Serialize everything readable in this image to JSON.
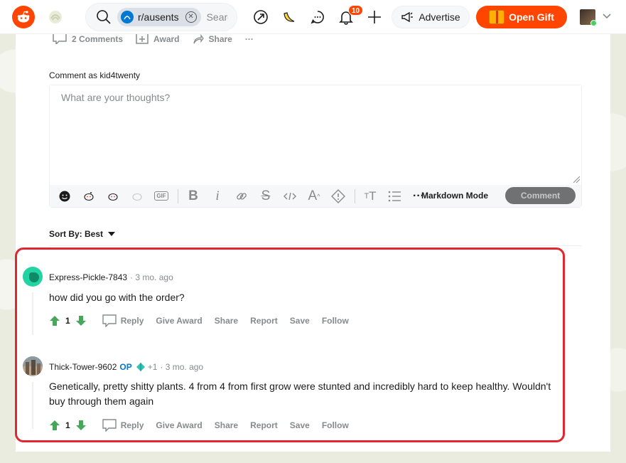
{
  "header": {
    "search": {
      "community_chip": "r/ausents",
      "placeholder": "Search Reddit"
    },
    "notification_count": "10",
    "advertise_label": "Advertise",
    "open_gift_label": "Open Gift"
  },
  "post_actions": {
    "comments": "2 Comments",
    "award": "Award",
    "share": "Share",
    "more": "···"
  },
  "editor": {
    "comment_as": "Comment as kid4twenty",
    "placeholder": "What are your thoughts?",
    "markdown_mode": "Markdown Mode",
    "comment_button": "Comment",
    "gif_label": "GIF"
  },
  "sort": {
    "label": "Sort By: Best"
  },
  "comments": [
    {
      "author": "Express-Pickle-7843",
      "ago": "· 3 mo. ago",
      "body": "how did you go with the order?",
      "score": "1",
      "actions": {
        "reply": "Reply",
        "give_award": "Give Award",
        "share": "Share",
        "report": "Report",
        "save": "Save",
        "follow": "Follow"
      }
    },
    {
      "author": "Thick-Tower-9602",
      "op": "OP",
      "flair_extra": "+1",
      "ago": "· 3 mo. ago",
      "body": "Genetically, pretty shitty plants. 4 from 4 from first grow were stunted and incredibly hard to keep healthy. Wouldn't buy through them again",
      "score": "1",
      "actions": {
        "reply": "Reply",
        "give_award": "Give Award",
        "share": "Share",
        "report": "Report",
        "save": "Save",
        "follow": "Follow"
      }
    }
  ],
  "colors": {
    "reddit_orange": "#ff4500",
    "highlight_border": "#e0262f",
    "upvote_green": "#46a758",
    "op_blue": "#0079d3"
  }
}
